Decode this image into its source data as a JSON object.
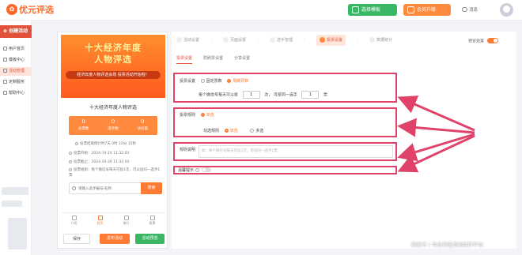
{
  "header": {
    "logo_text": "优元评选",
    "choose_template": "选择模板",
    "upgrade": "会员升级",
    "messages": "消息"
  },
  "sidebar": {
    "create": "创建活动",
    "items": [
      {
        "label": "用户首页",
        "icon": "home-icon"
      },
      {
        "label": "模板中心",
        "icon": "template-icon"
      },
      {
        "label": "活动管理",
        "icon": "activity-icon",
        "active": true
      },
      {
        "label": "定制服务",
        "icon": "custom-icon"
      },
      {
        "label": "帮助中心",
        "icon": "help-icon"
      }
    ]
  },
  "preview": {
    "banner_line1": "十大经济年度",
    "banner_line2": "人物评选",
    "banner_sub": "经济年度人物评选会场  投票活动开始啦！",
    "card_title": "十大经济年度人物评选",
    "stats": [
      {
        "value": "0",
        "label": "总票数"
      },
      {
        "value": "0",
        "label": "选手数"
      },
      {
        "value": "0",
        "label": "访问量"
      }
    ],
    "countdown": "投票结束倒计时7天 0时 10分 15秒",
    "start": "投票开始：2024-10-24 11:32:03",
    "end": "投票截止：2024-10-30 11:32:03",
    "rule": "投票规则：每个微信号每天可投1次，可以投同一选手1票",
    "search_placeholder": "请输入选手编号/名称",
    "search_button": "搜索",
    "tabs": [
      {
        "label": "介绍"
      },
      {
        "label": "首页",
        "active": true
      },
      {
        "label": "排行"
      },
      {
        "label": "投票"
      }
    ],
    "buttons": {
      "save": "保存",
      "publish": "发布活动",
      "view": "活动预览"
    }
  },
  "editor": {
    "steps": [
      {
        "label": "活动设置"
      },
      {
        "label": "页面设置"
      },
      {
        "label": "选手管理"
      },
      {
        "label": "投票设置",
        "active": true
      },
      {
        "label": "数据统计"
      }
    ],
    "preview_toggle_label": "预览效果",
    "subtabs": [
      {
        "label": "投票设置",
        "active": true
      },
      {
        "label": "防刷票设置"
      },
      {
        "label": "分享设置"
      }
    ],
    "vote_setting": {
      "label": "投票设置",
      "opt1": "固定票数",
      "opt2": "周期票数",
      "line_prefix": "每个微信号每天可以投",
      "count1": "1",
      "count1_unit": "次，",
      "line_mid": "可投同一选手",
      "count2": "1",
      "count2_unit": "票"
    },
    "vote_rule": {
      "label": "投票规则",
      "opt1": "单选",
      "sub_label": "勾选规则",
      "sub_opt1": "单选",
      "sub_opt2": "多选"
    },
    "rule_desc": {
      "label": "规则说明",
      "placeholder": "如：每个微信号每天可投1次，可投同一选手1票"
    },
    "vote_tip": {
      "label": "温馨提示"
    }
  },
  "watermark": "网易号 | 专业评选活动制作平台",
  "colors": {
    "accent": "#ff7a33",
    "red": "#e2523a",
    "green": "#3ab765",
    "highlight": "#e0436a"
  }
}
